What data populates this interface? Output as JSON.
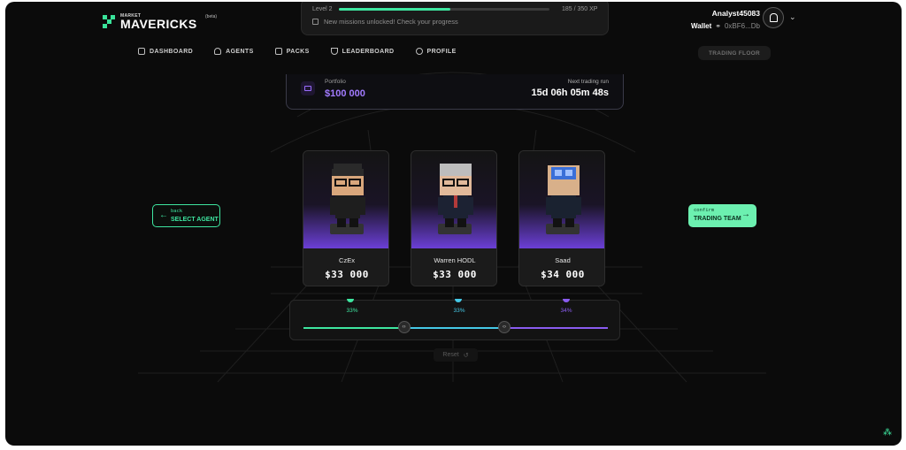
{
  "brand": {
    "small": "MARKET",
    "name": "MAVERICKS",
    "tag": "(beta)"
  },
  "xp": {
    "level": "Level 2",
    "value": "185 / 350 XP",
    "progress": 0.53,
    "message": "New missions unlocked! Check your progress"
  },
  "user": {
    "name": "Analyst45083",
    "wallet_label": "Wallet",
    "wallet_address": "0xBF6...Db"
  },
  "nav": {
    "items": [
      {
        "label": "DASHBOARD",
        "icon": "dashboard-icon"
      },
      {
        "label": "AGENTS",
        "icon": "agents-icon"
      },
      {
        "label": "PACKS",
        "icon": "packs-icon"
      },
      {
        "label": "LEADERBOARD",
        "icon": "trophy-icon"
      },
      {
        "label": "PROFILE",
        "icon": "profile-icon"
      }
    ],
    "trading_floor": "TRADING FLOOR"
  },
  "portfolio": {
    "label": "Portfolio",
    "value": "$100 000",
    "next_label": "Next trading run",
    "next_value": "15d 06h 05m 48s"
  },
  "back": {
    "small": "back",
    "label": "SELECT AGENT"
  },
  "confirm": {
    "small": "confirm",
    "label": "TRADING TEAM"
  },
  "agents": [
    {
      "name": "CzEx",
      "price": "$33 000"
    },
    {
      "name": "Warren HODL",
      "price": "$33 000"
    },
    {
      "name": "Saad",
      "price": "$34 000"
    }
  ],
  "allocation": {
    "percentages": [
      "33%",
      "33%",
      "34%"
    ],
    "values": [
      0.33,
      0.33,
      0.34
    ],
    "colors": [
      "#3ee6a0",
      "#45c8e6",
      "#8a5cf0"
    ]
  },
  "reset_label": "Reset",
  "colors": {
    "accent": "#3ee6a0",
    "purple": "#a27bff",
    "background": "#0b0b0b"
  }
}
